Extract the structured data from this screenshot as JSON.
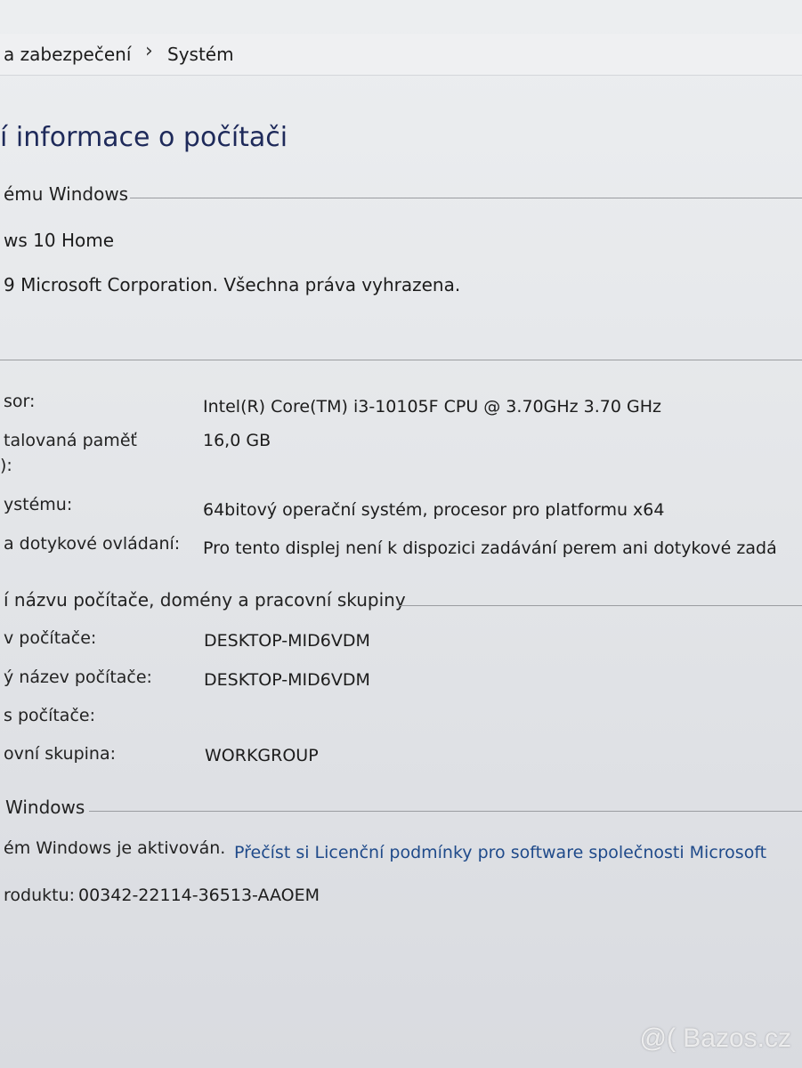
{
  "breadcrumb": {
    "items": [
      "a zabezpečení",
      "Systém"
    ],
    "separator": "›"
  },
  "page_title": "í informace o počítači",
  "windows_edition": {
    "header": "ému Windows",
    "edition": "ws 10 Home",
    "copyright": "9 Microsoft Corporation. Všechna práva vyhrazena."
  },
  "system": {
    "rows": [
      {
        "label": "sor:",
        "value": "Intel(R) Core(TM) i3-10105F CPU @ 3.70GHz   3.70 GHz"
      },
      {
        "label": "talovaná paměť",
        "label2": "):",
        "value": "16,0 GB"
      },
      {
        "label": "ystému:",
        "value": "64bitový operační systém, procesor pro platformu x64"
      },
      {
        "label": "a dotykové ovládaní:",
        "value": "Pro tento displej není k dispozici zadávání perem ani dotykové zadá"
      }
    ]
  },
  "computer_name": {
    "header": "í názvu počítače, domény a pracovní skupiny",
    "rows": [
      {
        "label": "v počítače:",
        "value": "DESKTOP-MID6VDM"
      },
      {
        "label": "ý název počítače:",
        "value": "DESKTOP-MID6VDM"
      },
      {
        "label": "s počítače:",
        "value": ""
      },
      {
        "label": "ovní skupina:",
        "value": "WORKGROUP"
      }
    ]
  },
  "activation": {
    "header": "Windows",
    "status": "ém Windows je aktivován.",
    "license_link": "Přečíst si Licenční podmínky pro software společnosti Microsoft",
    "product_id_label": "roduktu:",
    "product_id": "00342-22114-36513-AAOEM"
  },
  "watermark": "@( Bazos.cz",
  "colors": {
    "title": "#1e2a5a",
    "link": "#1f4a8a",
    "rule": "#9a9ca0"
  }
}
